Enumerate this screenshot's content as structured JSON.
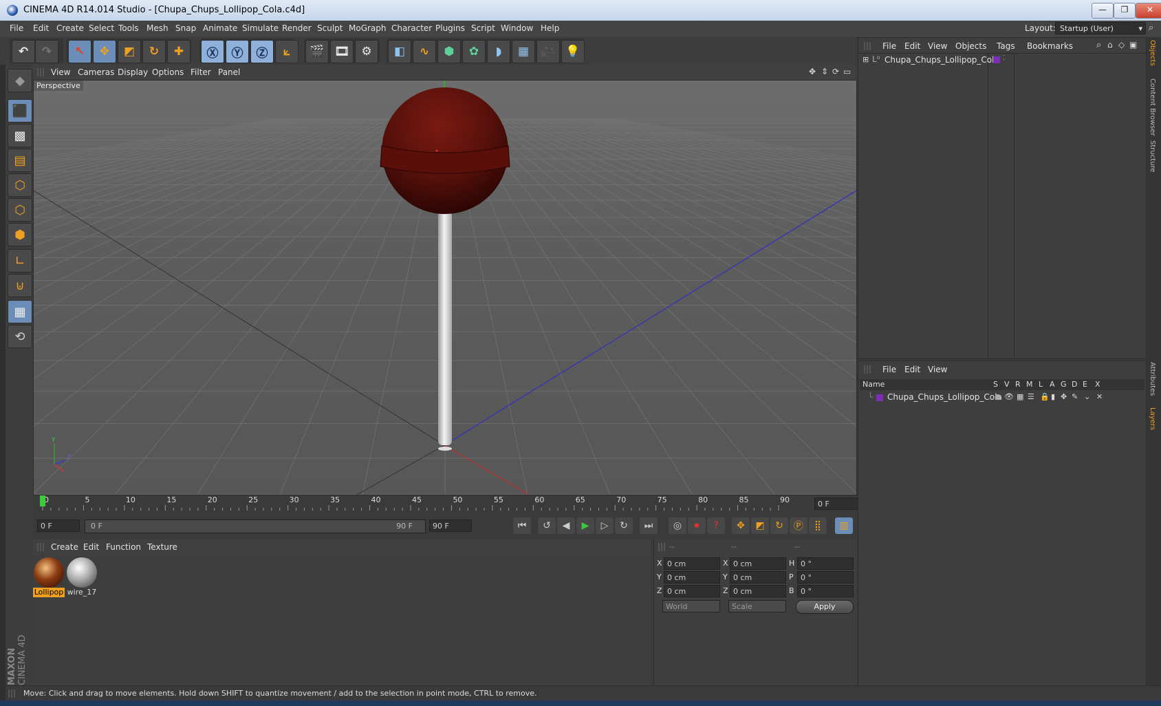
{
  "window": {
    "title": "CINEMA 4D R14.014 Studio - [Chupa_Chups_Lollipop_Cola.c4d]",
    "minimize": "—",
    "restore": "❐",
    "close": "✕"
  },
  "menubar": {
    "items": [
      "File",
      "Edit",
      "Create",
      "Select",
      "Tools",
      "Mesh",
      "Snap",
      "Animate",
      "Simulate",
      "Render",
      "Sculpt",
      "MoGraph",
      "Character",
      "Plugins",
      "Script",
      "Window",
      "Help"
    ],
    "layout_label": "Layout:",
    "layout_value": "Startup (User)"
  },
  "viewport": {
    "menu": [
      "View",
      "Cameras",
      "Display",
      "Options",
      "Filter",
      "Panel"
    ],
    "camera_label": "Perspective",
    "axis_y": "Y",
    "axis_z": "Z"
  },
  "timeline": {
    "ticks": [
      "0",
      "5",
      "10",
      "15",
      "20",
      "25",
      "30",
      "35",
      "40",
      "45",
      "50",
      "55",
      "60",
      "65",
      "70",
      "75",
      "80",
      "85",
      "90"
    ],
    "current_frame_field": "0 F",
    "start_field": "0 F",
    "range_start": "0 F",
    "range_end": "90 F",
    "end_field": "90 F",
    "playhead": 0,
    "max_frame": 90
  },
  "materials": {
    "menu": [
      "Create",
      "Edit",
      "Function",
      "Texture"
    ],
    "items": [
      {
        "name": "Lollipop",
        "selected": true
      },
      {
        "name": "wire_17",
        "selected": false
      }
    ]
  },
  "coordinates": {
    "header": [
      "--",
      "--",
      "--"
    ],
    "rows": [
      {
        "a": "X",
        "av": "0 cm",
        "b": "X",
        "bv": "0 cm",
        "c": "H",
        "cv": "0 °"
      },
      {
        "a": "Y",
        "av": "0 cm",
        "b": "Y",
        "bv": "0 cm",
        "c": "P",
        "cv": "0 °"
      },
      {
        "a": "Z",
        "av": "0 cm",
        "b": "Z",
        "bv": "0 cm",
        "c": "B",
        "cv": "0 °"
      }
    ],
    "mode_world": "World",
    "mode_scale": "Scale",
    "apply": "Apply"
  },
  "objects_panel": {
    "menu": [
      "File",
      "Edit",
      "View",
      "Objects",
      "Tags",
      "Bookmarks"
    ],
    "object_name": "Chupa_Chups_Lollipop_Cola"
  },
  "layers_panel": {
    "menu": [
      "File",
      "Edit",
      "View"
    ],
    "columns": [
      "Name",
      "S",
      "V",
      "R",
      "M",
      "L",
      "A",
      "G",
      "D",
      "E",
      "X"
    ],
    "layer_name": "Chupa_Chups_Lollipop_Cola"
  },
  "side_tabs": [
    "Objects",
    "Content Browser",
    "Structure",
    "Attributes",
    "Layers"
  ],
  "branding": {
    "maxon": "MAXON",
    "cinema": "CINEMA 4D"
  },
  "status": "Move: Click and drag to move elements. Hold down SHIFT to quantize movement / add to the selection in point mode, CTRL to remove.",
  "colors": {
    "accent": "#f0a020",
    "selected_tool": "#6b8db8",
    "lollipop_head": "#5c0d08",
    "layer_color": "#7b2fb5"
  }
}
